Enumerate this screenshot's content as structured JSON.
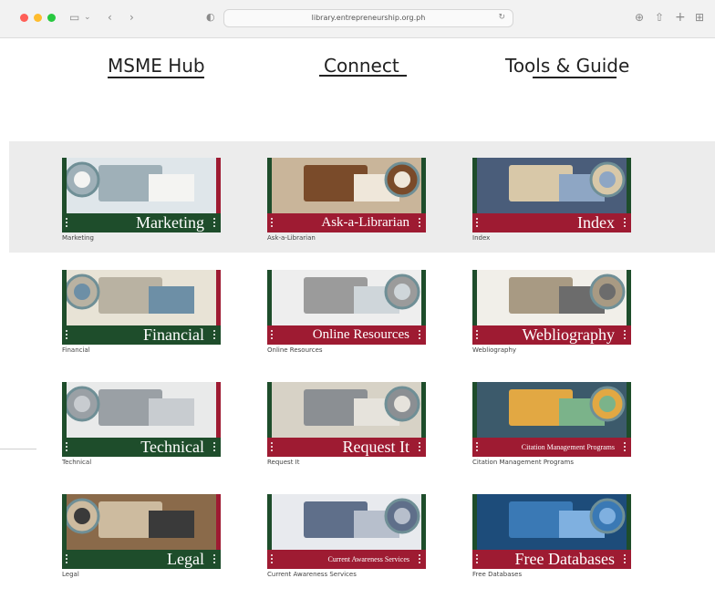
{
  "browser": {
    "url": "library.entrepreneurship.org.ph"
  },
  "nav": {
    "items": [
      {
        "label": "MSME Hub"
      },
      {
        "label": "Connect"
      },
      {
        "label": "Tools & Guide"
      }
    ]
  },
  "colors": {
    "green": "#1e4d2b",
    "red": "#9e1b32",
    "band": "#ececec"
  },
  "cards": [
    {
      "title": "Marketing",
      "caption": "Marketing",
      "bar": "green",
      "icon": "magnifier-hand-icon"
    },
    {
      "title": "Ask-a-Librarian",
      "caption": "Ask-a-Librarian",
      "bar": "red",
      "icon": "book-stack-icon"
    },
    {
      "title": "Index",
      "caption": "Index",
      "bar": "red",
      "icon": "desk-icon"
    },
    {
      "title": "Financial",
      "caption": "Financial",
      "bar": "green",
      "icon": "calculator-icon"
    },
    {
      "title": "Online Resources",
      "caption": "Online Resources",
      "bar": "red",
      "icon": "laptop-icon"
    },
    {
      "title": "Webliography",
      "caption": "Webliography",
      "bar": "red",
      "icon": "books-mouse-icon"
    },
    {
      "title": "Technical",
      "caption": "Technical",
      "bar": "green",
      "icon": "gears-icon"
    },
    {
      "title": "Request It",
      "caption": "Request It",
      "bar": "red",
      "icon": "keyboard-icon"
    },
    {
      "title": "Citation Management Programs",
      "caption": "Citation Management Programs",
      "bar": "red",
      "icon": "sticky-notes-icon"
    },
    {
      "title": "Legal",
      "caption": "Legal",
      "bar": "green",
      "icon": "gavel-icon"
    },
    {
      "title": "Current Awareness Services",
      "caption": "Current Awareness Services",
      "bar": "red",
      "icon": "lightbulbs-icon"
    },
    {
      "title": "Free Databases",
      "caption": "Free Databases",
      "bar": "red",
      "icon": "database-icon"
    }
  ]
}
